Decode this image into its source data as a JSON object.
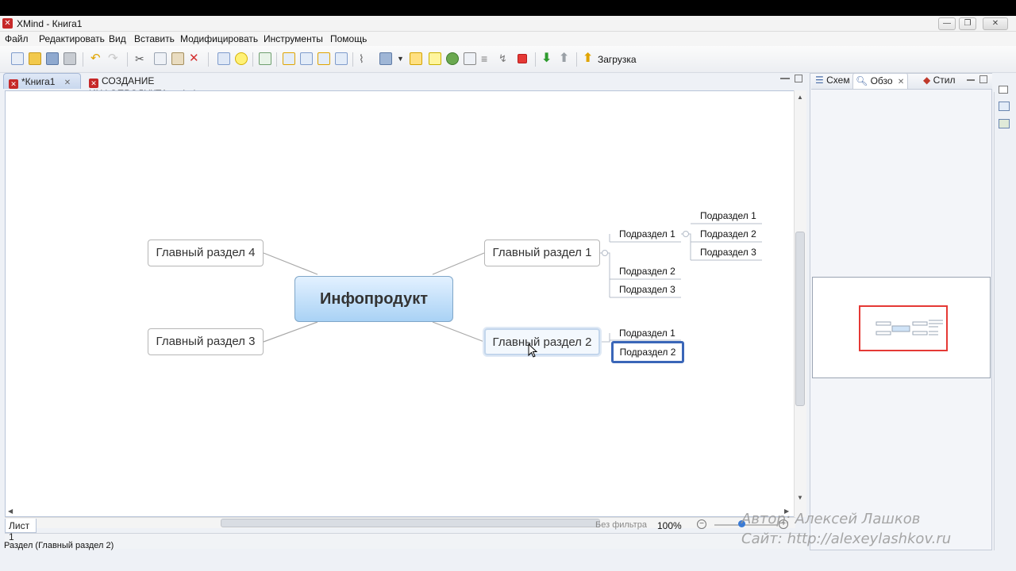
{
  "window": {
    "title": "XMind - Книга1",
    "controls": {
      "minimize": "—",
      "restore": "❐",
      "close": "✕"
    }
  },
  "menu": [
    "Файл",
    "Редактировать",
    "Вид",
    "Вставить",
    "Модифицировать",
    "Инструменты",
    "Помощь"
  ],
  "toolbar": {
    "upload_label": "Загрузка",
    "icons": [
      "new-file-icon",
      "open-folder-icon",
      "save-icon",
      "print-icon",
      "undo-icon",
      "redo-icon",
      "cut-icon",
      "copy-icon",
      "paste-icon",
      "delete-icon",
      "topic-icon",
      "idea-icon",
      "fit-map-icon",
      "insert-topic-icon",
      "insert-subtopic-icon",
      "insert-parent-icon",
      "insert-detached-icon",
      "attachment-icon",
      "image-icon",
      "dropdown-arrow-icon",
      "marker-icon",
      "note-icon",
      "hyperlink-icon",
      "boundary-icon",
      "summary-icon",
      "relationship-icon",
      "stop-icon",
      "drill-down-icon",
      "drill-up-icon",
      "upload-icon"
    ]
  },
  "editor_tabs": [
    {
      "label": "*Книга1",
      "active": true
    },
    {
      "label": "СОЗДАНИЕ ИНФОПРОДУКТА.xmind",
      "active": false
    }
  ],
  "mindmap": {
    "central": "Инфопродукт",
    "topics": {
      "t1": "Главный раздел 1",
      "t2": "Главный раздел 2",
      "t3": "Главный раздел 3",
      "t4": "Главный раздел 4"
    },
    "t1_subtopics": [
      "Подраздел 1",
      "Подраздел 2",
      "Подраздел 3"
    ],
    "t1_sub1_children": [
      "Подраздел 1",
      "Подраздел 2",
      "Подраздел 3"
    ],
    "t2_subtopics": [
      "Подраздел 1",
      "Подраздел 2"
    ]
  },
  "sheet": {
    "tab_label": "Лист 1",
    "filter_label": "Без фильтра",
    "zoom": "100%"
  },
  "right_panel": {
    "tabs": [
      "Схем",
      "Обзо",
      "Стил"
    ]
  },
  "status": {
    "text": "Раздел (Главный раздел 2)"
  },
  "watermark": {
    "author": "Автор: Алексей Лашков",
    "site": "Сайт: http://alexeylashkov.ru"
  },
  "colors": {
    "central_fill": "#a9d2f5",
    "selection": "#3a66b8",
    "overview_frame": "#e53935",
    "xmind_red": "#c62828"
  }
}
